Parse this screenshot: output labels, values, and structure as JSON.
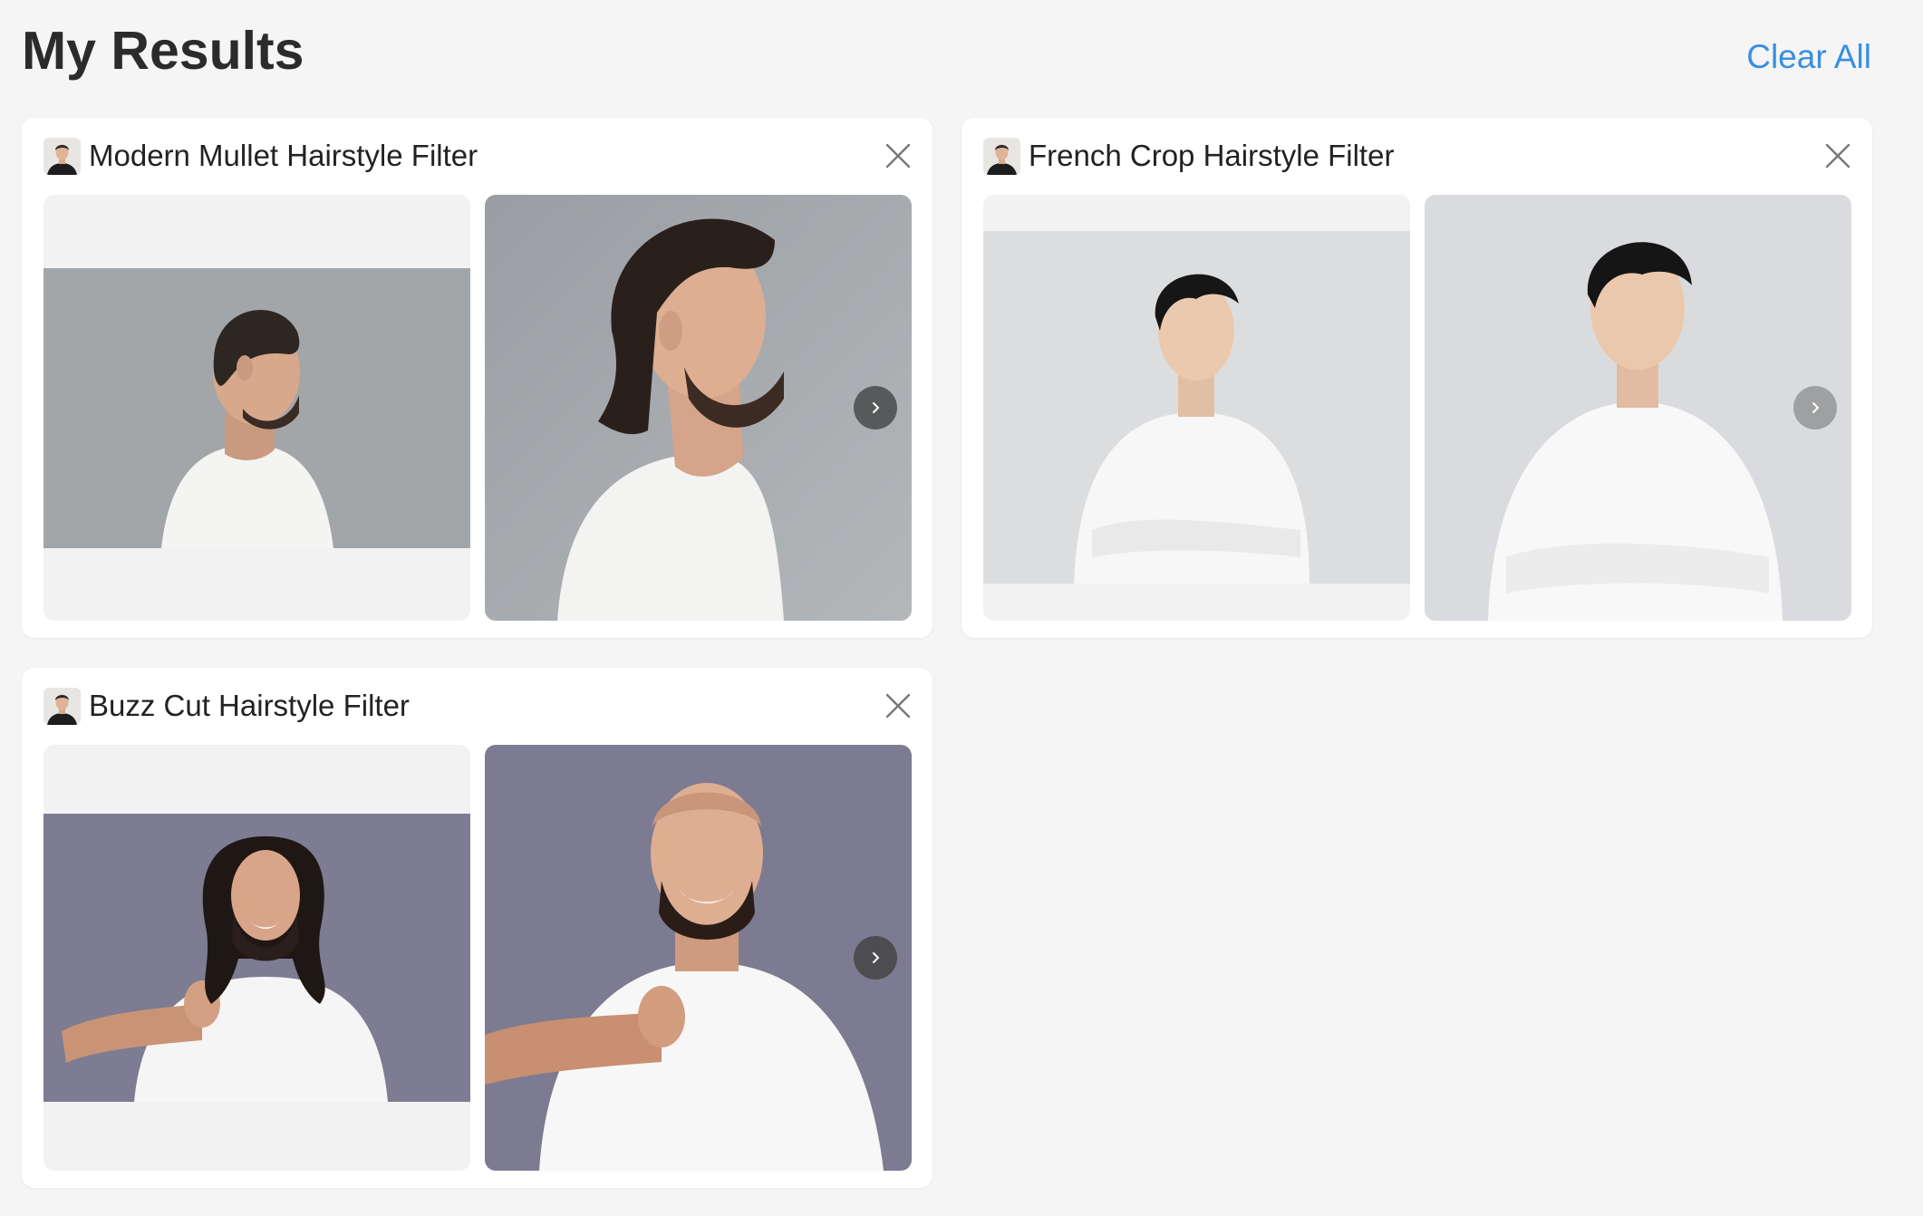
{
  "header": {
    "title": "My Results",
    "clear_all_label": "Clear All"
  },
  "results": [
    {
      "title": "Modern Mullet Hairstyle Filter",
      "close_icon": "close-icon",
      "next_icon": "chevron-right-icon"
    },
    {
      "title": "French Crop Hairstyle Filter",
      "close_icon": "close-icon",
      "next_icon": "chevron-right-icon"
    },
    {
      "title": "Buzz Cut Hairstyle Filter",
      "close_icon": "close-icon",
      "next_icon": "chevron-right-icon"
    }
  ],
  "colors": {
    "accent": "#3a8fe0",
    "background": "#f5f5f5",
    "card": "#ffffff"
  }
}
